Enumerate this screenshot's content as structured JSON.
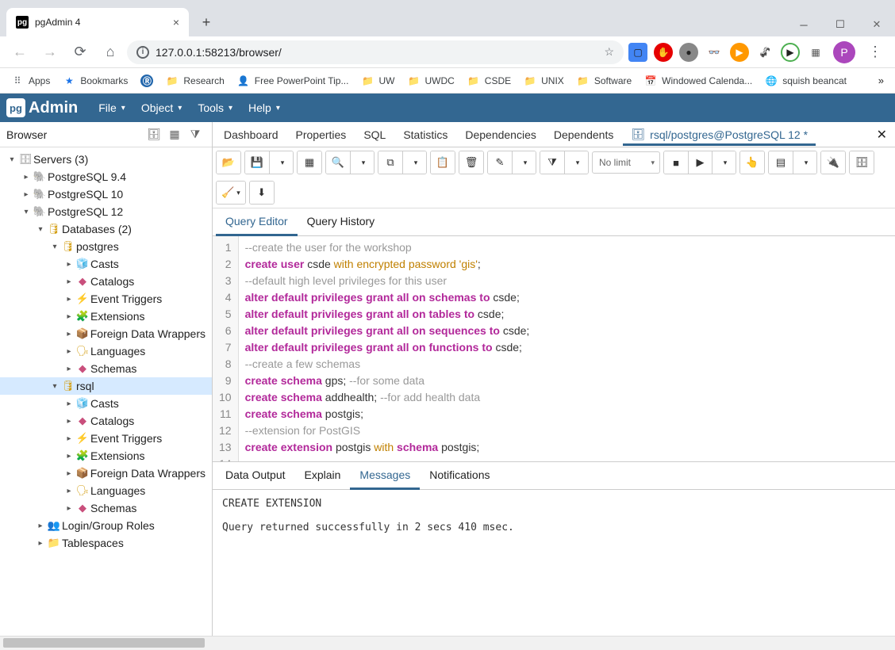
{
  "browser": {
    "tab_title": "pgAdmin 4",
    "url": "127.0.0.1:58213/browser/",
    "avatar_letter": "P"
  },
  "bookmarks": [
    {
      "label": "Apps",
      "icon": "apps"
    },
    {
      "label": "Bookmarks",
      "icon": "star"
    },
    {
      "label": "",
      "icon": "R"
    },
    {
      "label": "Research",
      "icon": "folder"
    },
    {
      "label": "Free PowerPoint Tip...",
      "icon": "ppt"
    },
    {
      "label": "UW",
      "icon": "folder"
    },
    {
      "label": "UWDC",
      "icon": "folder"
    },
    {
      "label": "CSDE",
      "icon": "folder"
    },
    {
      "label": "UNIX",
      "icon": "folder"
    },
    {
      "label": "Software",
      "icon": "folder"
    },
    {
      "label": "Windowed Calenda...",
      "icon": "cal"
    },
    {
      "label": "squish beancat",
      "icon": "globe"
    }
  ],
  "menubar": [
    "File",
    "Object",
    "Tools",
    "Help"
  ],
  "browser_panel": {
    "title": "Browser"
  },
  "tree": [
    {
      "depth": 0,
      "exp": "▾",
      "icon": "🗄",
      "label": "Servers (3)",
      "color": "#888"
    },
    {
      "depth": 1,
      "exp": "▸",
      "icon": "🐘",
      "label": "PostgreSQL 9.4",
      "color": "#888"
    },
    {
      "depth": 1,
      "exp": "▸",
      "icon": "🐘",
      "label": "PostgreSQL 10",
      "color": "#888"
    },
    {
      "depth": 1,
      "exp": "▾",
      "icon": "🐘",
      "label": "PostgreSQL 12",
      "color": "#326690"
    },
    {
      "depth": 2,
      "exp": "▾",
      "icon": "🛢",
      "label": "Databases (2)",
      "color": "#d4a017"
    },
    {
      "depth": 3,
      "exp": "▾",
      "icon": "🛢",
      "label": "postgres",
      "color": "#d4a017"
    },
    {
      "depth": 4,
      "exp": "▸",
      "icon": "🧊",
      "label": "Casts",
      "color": "#888"
    },
    {
      "depth": 4,
      "exp": "▸",
      "icon": "◆",
      "label": "Catalogs",
      "color": "#c94f7c"
    },
    {
      "depth": 4,
      "exp": "▸",
      "icon": "⚡",
      "label": "Event Triggers",
      "color": "#888"
    },
    {
      "depth": 4,
      "exp": "▸",
      "icon": "🧩",
      "label": "Extensions",
      "color": "#888"
    },
    {
      "depth": 4,
      "exp": "▸",
      "icon": "📦",
      "label": "Foreign Data Wrappers",
      "color": "#d4a017"
    },
    {
      "depth": 4,
      "exp": "▸",
      "icon": "🗣",
      "label": "Languages",
      "color": "#d4a017"
    },
    {
      "depth": 4,
      "exp": "▸",
      "icon": "◆",
      "label": "Schemas",
      "color": "#c94f7c"
    },
    {
      "depth": 3,
      "exp": "▾",
      "icon": "🛢",
      "label": "rsql",
      "color": "#d4a017",
      "selected": true
    },
    {
      "depth": 4,
      "exp": "▸",
      "icon": "🧊",
      "label": "Casts",
      "color": "#888"
    },
    {
      "depth": 4,
      "exp": "▸",
      "icon": "◆",
      "label": "Catalogs",
      "color": "#c94f7c"
    },
    {
      "depth": 4,
      "exp": "▸",
      "icon": "⚡",
      "label": "Event Triggers",
      "color": "#888"
    },
    {
      "depth": 4,
      "exp": "▸",
      "icon": "🧩",
      "label": "Extensions",
      "color": "#888"
    },
    {
      "depth": 4,
      "exp": "▸",
      "icon": "📦",
      "label": "Foreign Data Wrappers",
      "color": "#d4a017"
    },
    {
      "depth": 4,
      "exp": "▸",
      "icon": "🗣",
      "label": "Languages",
      "color": "#d4a017"
    },
    {
      "depth": 4,
      "exp": "▸",
      "icon": "◆",
      "label": "Schemas",
      "color": "#c94f7c"
    },
    {
      "depth": 2,
      "exp": "▸",
      "icon": "👥",
      "label": "Login/Group Roles",
      "color": "#888"
    },
    {
      "depth": 2,
      "exp": "▸",
      "icon": "📁",
      "label": "Tablespaces",
      "color": "#d4a017"
    }
  ],
  "main_tabs": [
    "Dashboard",
    "Properties",
    "SQL",
    "Statistics",
    "Dependencies",
    "Dependents"
  ],
  "active_tab": {
    "label": "rsql/postgres@PostgreSQL 12 *"
  },
  "toolbar_limit": "No limit",
  "editor_tabs": [
    "Query Editor",
    "Query History"
  ],
  "sql_lines": [
    [
      {
        "t": "--create the user for the workshop",
        "c": "cm"
      }
    ],
    [
      {
        "t": "create",
        "c": "kw"
      },
      {
        "t": " ",
        "c": "id"
      },
      {
        "t": "user",
        "c": "kw"
      },
      {
        "t": " csde ",
        "c": "id"
      },
      {
        "t": "with",
        "c": "kw2"
      },
      {
        "t": " ",
        "c": "id"
      },
      {
        "t": "encrypted",
        "c": "kw2"
      },
      {
        "t": " ",
        "c": "id"
      },
      {
        "t": "password",
        "c": "kw2"
      },
      {
        "t": " ",
        "c": "id"
      },
      {
        "t": "'gis'",
        "c": "str"
      },
      {
        "t": ";",
        "c": "id"
      }
    ],
    [
      {
        "t": "--default high level privileges for this user",
        "c": "cm"
      }
    ],
    [
      {
        "t": "alter",
        "c": "kw"
      },
      {
        "t": " ",
        "c": "id"
      },
      {
        "t": "default",
        "c": "kw"
      },
      {
        "t": " ",
        "c": "id"
      },
      {
        "t": "privileges",
        "c": "kw"
      },
      {
        "t": " ",
        "c": "id"
      },
      {
        "t": "grant",
        "c": "kw"
      },
      {
        "t": " ",
        "c": "id"
      },
      {
        "t": "all",
        "c": "kw"
      },
      {
        "t": " ",
        "c": "id"
      },
      {
        "t": "on",
        "c": "kw"
      },
      {
        "t": " ",
        "c": "id"
      },
      {
        "t": "schemas",
        "c": "kw"
      },
      {
        "t": " ",
        "c": "id"
      },
      {
        "t": "to",
        "c": "kw"
      },
      {
        "t": " csde;",
        "c": "id"
      }
    ],
    [
      {
        "t": "alter",
        "c": "kw"
      },
      {
        "t": " ",
        "c": "id"
      },
      {
        "t": "default",
        "c": "kw"
      },
      {
        "t": " ",
        "c": "id"
      },
      {
        "t": "privileges",
        "c": "kw"
      },
      {
        "t": " ",
        "c": "id"
      },
      {
        "t": "grant",
        "c": "kw"
      },
      {
        "t": " ",
        "c": "id"
      },
      {
        "t": "all",
        "c": "kw"
      },
      {
        "t": " ",
        "c": "id"
      },
      {
        "t": "on",
        "c": "kw"
      },
      {
        "t": " ",
        "c": "id"
      },
      {
        "t": "tables",
        "c": "kw"
      },
      {
        "t": " ",
        "c": "id"
      },
      {
        "t": "to",
        "c": "kw"
      },
      {
        "t": " csde;",
        "c": "id"
      }
    ],
    [
      {
        "t": "alter",
        "c": "kw"
      },
      {
        "t": " ",
        "c": "id"
      },
      {
        "t": "default",
        "c": "kw"
      },
      {
        "t": " ",
        "c": "id"
      },
      {
        "t": "privileges",
        "c": "kw"
      },
      {
        "t": " ",
        "c": "id"
      },
      {
        "t": "grant",
        "c": "kw"
      },
      {
        "t": " ",
        "c": "id"
      },
      {
        "t": "all",
        "c": "kw"
      },
      {
        "t": " ",
        "c": "id"
      },
      {
        "t": "on",
        "c": "kw"
      },
      {
        "t": " ",
        "c": "id"
      },
      {
        "t": "sequences",
        "c": "kw"
      },
      {
        "t": " ",
        "c": "id"
      },
      {
        "t": "to",
        "c": "kw"
      },
      {
        "t": " csde;",
        "c": "id"
      }
    ],
    [
      {
        "t": "alter",
        "c": "kw"
      },
      {
        "t": " ",
        "c": "id"
      },
      {
        "t": "default",
        "c": "kw"
      },
      {
        "t": " ",
        "c": "id"
      },
      {
        "t": "privileges",
        "c": "kw"
      },
      {
        "t": " ",
        "c": "id"
      },
      {
        "t": "grant",
        "c": "kw"
      },
      {
        "t": " ",
        "c": "id"
      },
      {
        "t": "all",
        "c": "kw"
      },
      {
        "t": " ",
        "c": "id"
      },
      {
        "t": "on",
        "c": "kw"
      },
      {
        "t": " ",
        "c": "id"
      },
      {
        "t": "functions",
        "c": "kw"
      },
      {
        "t": " ",
        "c": "id"
      },
      {
        "t": "to",
        "c": "kw"
      },
      {
        "t": " csde;",
        "c": "id"
      }
    ],
    [
      {
        "t": "--create a few schemas",
        "c": "cm"
      }
    ],
    [
      {
        "t": "create",
        "c": "kw"
      },
      {
        "t": " ",
        "c": "id"
      },
      {
        "t": "schema",
        "c": "kw"
      },
      {
        "t": " gps; ",
        "c": "id"
      },
      {
        "t": "--for some data",
        "c": "cm"
      }
    ],
    [
      {
        "t": "create",
        "c": "kw"
      },
      {
        "t": " ",
        "c": "id"
      },
      {
        "t": "schema",
        "c": "kw"
      },
      {
        "t": " addhealth; ",
        "c": "id"
      },
      {
        "t": "--for add health data",
        "c": "cm"
      }
    ],
    [
      {
        "t": "create",
        "c": "kw"
      },
      {
        "t": " ",
        "c": "id"
      },
      {
        "t": "schema",
        "c": "kw"
      },
      {
        "t": " postgis;",
        "c": "id"
      }
    ],
    [
      {
        "t": "--extension for PostGIS",
        "c": "cm"
      }
    ],
    [
      {
        "t": "create",
        "c": "kw"
      },
      {
        "t": " ",
        "c": "id"
      },
      {
        "t": "extension",
        "c": "kw"
      },
      {
        "t": " postgis ",
        "c": "id"
      },
      {
        "t": "with",
        "c": "kw2"
      },
      {
        "t": " ",
        "c": "id"
      },
      {
        "t": "schema",
        "c": "kw"
      },
      {
        "t": " postgis;",
        "c": "id"
      }
    ],
    []
  ],
  "output_tabs": [
    "Data Output",
    "Explain",
    "Messages",
    "Notifications"
  ],
  "messages": "CREATE EXTENSION\n\nQuery returned successfully in 2 secs 410 msec."
}
